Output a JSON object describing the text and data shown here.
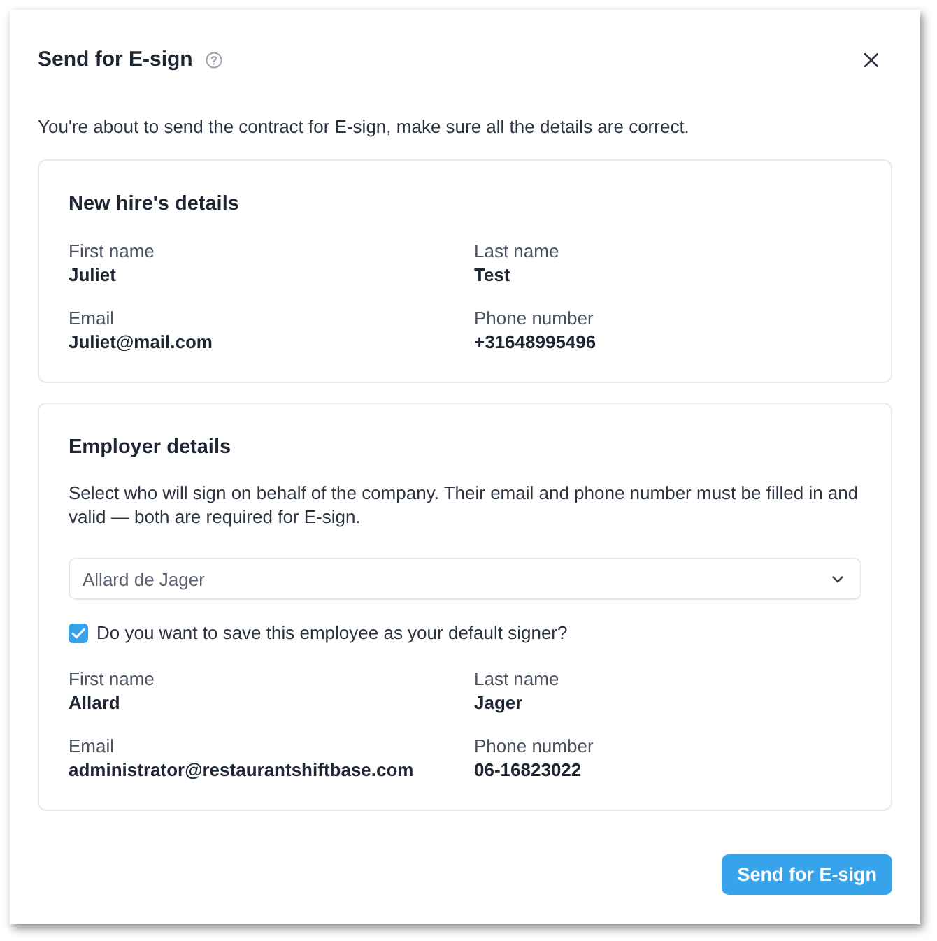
{
  "dialog": {
    "title": "Send for E-sign",
    "intro": "You're about to send the contract for E-sign, make sure all the details are correct."
  },
  "new_hire": {
    "title": "New hire's details",
    "fields": [
      {
        "label": "First name",
        "value": "Juliet"
      },
      {
        "label": "Last name",
        "value": "Test"
      },
      {
        "label": "Email",
        "value": "Juliet@mail.com"
      },
      {
        "label": "Phone number",
        "value": "+31648995496"
      }
    ]
  },
  "employer": {
    "title": "Employer details",
    "description": "Select who will sign on behalf of the company. Their email and phone number must be filled in and valid — both are required for E-sign.",
    "signer_select": {
      "value": "Allard de Jager"
    },
    "default_signer": {
      "label": "Do you want to save this employee as your default signer?",
      "checked": true
    },
    "fields": [
      {
        "label": "First name",
        "value": "Allard"
      },
      {
        "label": "Last name",
        "value": "Jager"
      },
      {
        "label": "Email",
        "value": "administrator@restaurantshiftbase.com"
      },
      {
        "label": "Phone number",
        "value": "06-16823022"
      }
    ]
  },
  "footer": {
    "button": "Send for E-sign"
  }
}
